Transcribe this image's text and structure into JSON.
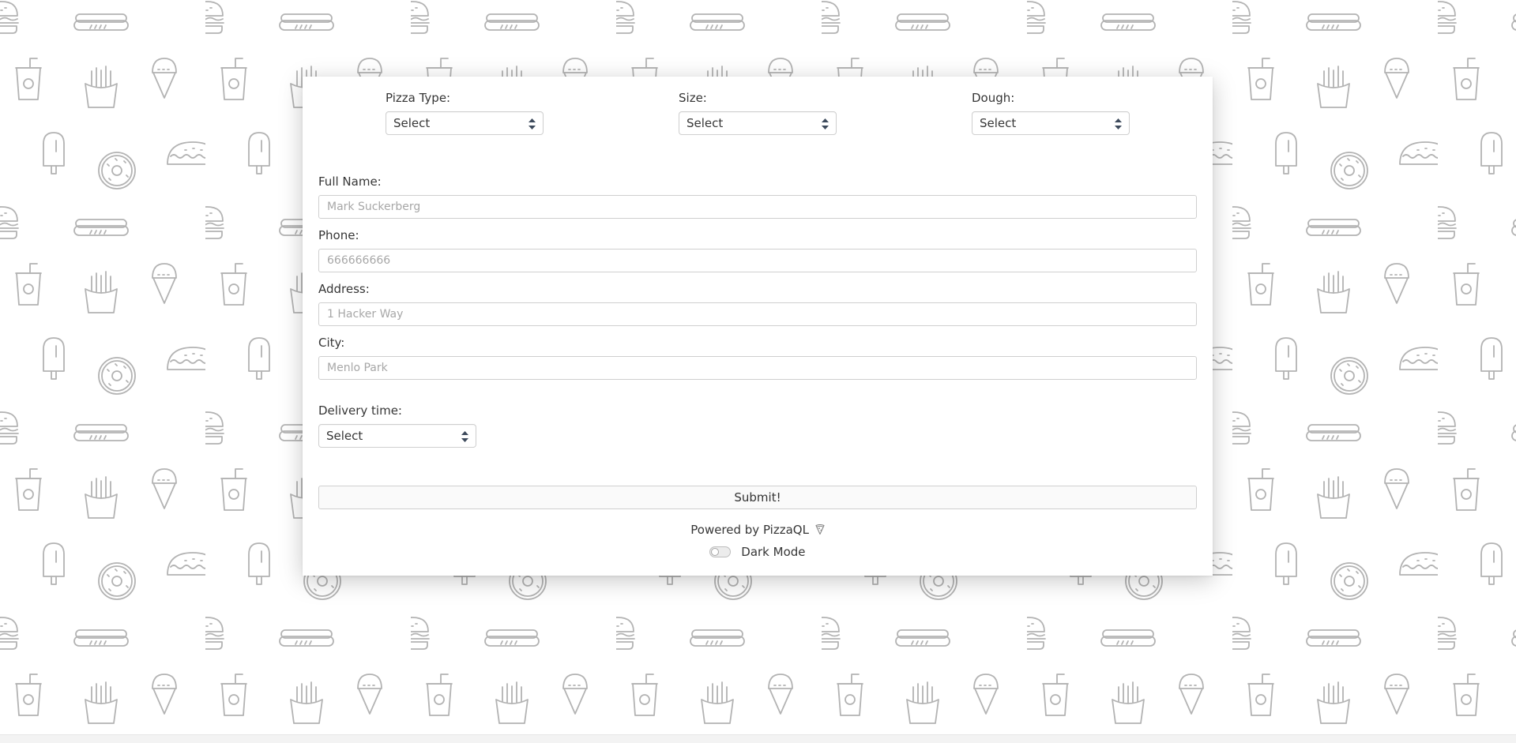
{
  "order_form": {
    "pizza_type": {
      "label": "Pizza Type:",
      "value": "Select"
    },
    "size": {
      "label": "Size:",
      "value": "Select"
    },
    "dough": {
      "label": "Dough:",
      "value": "Select"
    },
    "full_name": {
      "label": "Full Name:",
      "placeholder": "Mark Suckerberg",
      "value": ""
    },
    "phone": {
      "label": "Phone:",
      "placeholder": "666666666",
      "value": ""
    },
    "address": {
      "label": "Address:",
      "placeholder": "1 Hacker Way",
      "value": ""
    },
    "city": {
      "label": "City:",
      "placeholder": "Menlo Park",
      "value": ""
    },
    "delivery_time": {
      "label": "Delivery time:",
      "value": "Select"
    },
    "submit_label": "Submit!"
  },
  "footer": {
    "powered_by": "Powered by PizzaQL",
    "powered_icon": "pizza-slice-icon",
    "dark_mode_label": "Dark Mode",
    "dark_mode_on": false
  },
  "background": {
    "pattern_icons": [
      "hotdog-icon",
      "burger-icon",
      "soda-cup-icon",
      "fries-icon",
      "ice-cream-cone-icon",
      "popsicle-icon",
      "donut-icon",
      "taco-icon"
    ],
    "icon_color": "#b3b3b3"
  }
}
